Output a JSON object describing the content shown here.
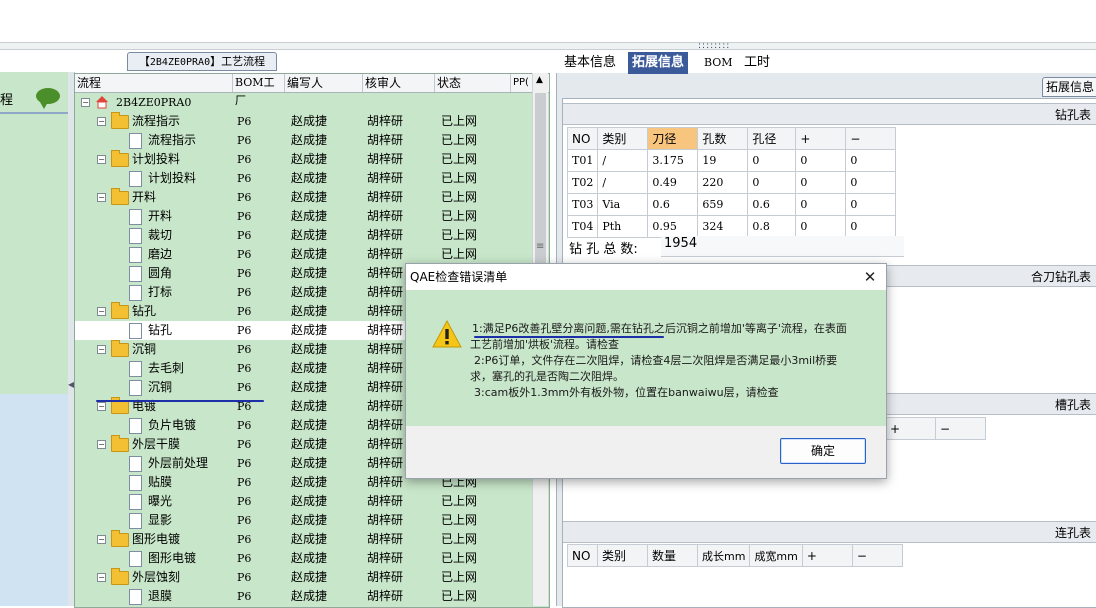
{
  "left_panel": {
    "label": "程",
    "comment_icon": "comment-bubble-icon"
  },
  "workflow_tab": {
    "bracket_open": "【",
    "code": "2B4ZE0PRA0",
    "bracket_close": "】",
    "label": "工艺流程"
  },
  "grid": {
    "columns": [
      "流程",
      "BOM工厂",
      "编写人",
      "核审人",
      "状态",
      "PP("
    ],
    "rows": [
      {
        "name": "2B4ZE0PRA0",
        "level": 0,
        "icon": "home-icon",
        "toggle": "−",
        "factory": "",
        "writer": "",
        "reviewer": "",
        "status": ""
      },
      {
        "name": "流程指示",
        "level": 1,
        "icon": "folder-icon",
        "toggle": "−",
        "factory": "P6",
        "writer": "赵成捷",
        "reviewer": "胡梓研",
        "status": "已上网"
      },
      {
        "name": "流程指示",
        "level": 2,
        "icon": "document-icon",
        "toggle": "",
        "factory": "P6",
        "writer": "赵成捷",
        "reviewer": "胡梓研",
        "status": "已上网"
      },
      {
        "name": "计划投料",
        "level": 1,
        "icon": "folder-icon",
        "toggle": "−",
        "factory": "P6",
        "writer": "赵成捷",
        "reviewer": "胡梓研",
        "status": "已上网"
      },
      {
        "name": "计划投料",
        "level": 2,
        "icon": "document-icon",
        "toggle": "",
        "factory": "P6",
        "writer": "赵成捷",
        "reviewer": "胡梓研",
        "status": "已上网"
      },
      {
        "name": "开料",
        "level": 1,
        "icon": "folder-icon",
        "toggle": "−",
        "factory": "P6",
        "writer": "赵成捷",
        "reviewer": "胡梓研",
        "status": "已上网"
      },
      {
        "name": "开料",
        "level": 2,
        "icon": "document-icon",
        "toggle": "",
        "factory": "P6",
        "writer": "赵成捷",
        "reviewer": "胡梓研",
        "status": "已上网"
      },
      {
        "name": "裁切",
        "level": 2,
        "icon": "document-icon",
        "toggle": "",
        "factory": "P6",
        "writer": "赵成捷",
        "reviewer": "胡梓研",
        "status": "已上网"
      },
      {
        "name": "磨边",
        "level": 2,
        "icon": "document-icon",
        "toggle": "",
        "factory": "P6",
        "writer": "赵成捷",
        "reviewer": "胡梓研",
        "status": "已上网"
      },
      {
        "name": "圆角",
        "level": 2,
        "icon": "document-icon",
        "toggle": "",
        "factory": "P6",
        "writer": "赵成捷",
        "reviewer": "胡梓研",
        "status": ""
      },
      {
        "name": "打标",
        "level": 2,
        "icon": "document-icon",
        "toggle": "",
        "factory": "P6",
        "writer": "赵成捷",
        "reviewer": "胡梓研",
        "status": ""
      },
      {
        "name": "钻孔",
        "level": 1,
        "icon": "folder-icon",
        "toggle": "−",
        "factory": "P6",
        "writer": "赵成捷",
        "reviewer": "胡梓研",
        "status": ""
      },
      {
        "name": "钻孔",
        "level": 2,
        "icon": "document-icon",
        "toggle": "",
        "factory": "P6",
        "writer": "赵成捷",
        "reviewer": "胡梓研",
        "status": "",
        "selected": true
      },
      {
        "name": "沉铜",
        "level": 1,
        "icon": "folder-icon",
        "toggle": "−",
        "factory": "P6",
        "writer": "赵成捷",
        "reviewer": "胡梓研",
        "status": ""
      },
      {
        "name": "去毛刺",
        "level": 2,
        "icon": "document-icon",
        "toggle": "",
        "factory": "P6",
        "writer": "赵成捷",
        "reviewer": "胡梓研",
        "status": ""
      },
      {
        "name": "沉铜",
        "level": 2,
        "icon": "document-icon",
        "toggle": "",
        "factory": "P6",
        "writer": "赵成捷",
        "reviewer": "胡梓研",
        "status": ""
      },
      {
        "name": "电镀",
        "level": 1,
        "icon": "folder-icon",
        "toggle": "−",
        "factory": "P6",
        "writer": "赵成捷",
        "reviewer": "胡梓研",
        "status": ""
      },
      {
        "name": "负片电镀",
        "level": 2,
        "icon": "document-icon",
        "toggle": "",
        "factory": "P6",
        "writer": "赵成捷",
        "reviewer": "胡梓研",
        "status": ""
      },
      {
        "name": "外层干膜",
        "level": 1,
        "icon": "folder-icon",
        "toggle": "−",
        "factory": "P6",
        "writer": "赵成捷",
        "reviewer": "胡梓研",
        "status": ""
      },
      {
        "name": "外层前处理",
        "level": 2,
        "icon": "document-icon",
        "toggle": "",
        "factory": "P6",
        "writer": "赵成捷",
        "reviewer": "胡梓研",
        "status": ""
      },
      {
        "name": "贴膜",
        "level": 2,
        "icon": "document-icon",
        "toggle": "",
        "factory": "P6",
        "writer": "赵成捷",
        "reviewer": "胡梓研",
        "status": "已上网"
      },
      {
        "name": "曝光",
        "level": 2,
        "icon": "document-icon",
        "toggle": "",
        "factory": "P6",
        "writer": "赵成捷",
        "reviewer": "胡梓研",
        "status": "已上网"
      },
      {
        "name": "显影",
        "level": 2,
        "icon": "document-icon",
        "toggle": "",
        "factory": "P6",
        "writer": "赵成捷",
        "reviewer": "胡梓研",
        "status": "已上网"
      },
      {
        "name": "图形电镀",
        "level": 1,
        "icon": "folder-icon",
        "toggle": "−",
        "factory": "P6",
        "writer": "赵成捷",
        "reviewer": "胡梓研",
        "status": "已上网"
      },
      {
        "name": "图形电镀",
        "level": 2,
        "icon": "document-icon",
        "toggle": "",
        "factory": "P6",
        "writer": "赵成捷",
        "reviewer": "胡梓研",
        "status": "已上网"
      },
      {
        "name": "外层蚀刻",
        "level": 1,
        "icon": "folder-icon",
        "toggle": "−",
        "factory": "P6",
        "writer": "赵成捷",
        "reviewer": "胡梓研",
        "status": "已上网"
      },
      {
        "name": "退膜",
        "level": 2,
        "icon": "document-icon",
        "toggle": "",
        "factory": "P6",
        "writer": "赵成捷",
        "reviewer": "胡梓研",
        "status": "已上网"
      }
    ]
  },
  "right_tabs": [
    {
      "label": "基本信息",
      "active": false
    },
    {
      "label": "拓展信息",
      "active": true
    },
    {
      "label": "BOM",
      "active": false
    },
    {
      "label": "工时",
      "active": false
    }
  ],
  "extended_info_tab": "拓展信息",
  "drill_table": {
    "title": "钻孔表",
    "headers": [
      "NO",
      "类别",
      "刀径",
      "孔数",
      "孔径",
      "+",
      "−"
    ],
    "highlight_header": "刀径",
    "rows": [
      [
        "T01",
        "/",
        "3.175",
        "19",
        "0",
        "0",
        "0"
      ],
      [
        "T02",
        "/",
        "0.49",
        "220",
        "0",
        "0",
        "0"
      ],
      [
        "T03",
        "Via",
        "0.6",
        "659",
        "0.6",
        "0",
        "0"
      ],
      [
        "T04",
        "Pth",
        "0.95",
        "324",
        "0.8",
        "0",
        "0"
      ]
    ],
    "total_label": "钻 孔 总 数:",
    "total_value": "1954"
  },
  "combo_drill_table": {
    "title": "合刀钻孔表"
  },
  "slot_table": {
    "title": "槽孔表",
    "headers": [
      "+",
      "−"
    ]
  },
  "link_table": {
    "title": "连孔表",
    "headers": [
      "NO",
      "类别",
      "数量",
      "成长mm",
      "成宽mm",
      "+",
      "−"
    ]
  },
  "dialog": {
    "title": "QAE检查错误清单",
    "warning_icon": "warning-icon",
    "close_icon": "close-icon",
    "lines": [
      "1:满足P6改善孔壁分离问题,需在钻孔之后沉铜之前增加'等离子'流程，在表面",
      "工艺前增加'烘板'流程。请检查",
      "2:P6订单，文件存在二次阻焊，请检查4层二次阻焊是否满足最小3mil桥要",
      "求，塞孔的孔是否陶二次阻焊。",
      "3:cam板外1.3mm外有板外物，位置在banwaiwu层，请检查"
    ],
    "ok_label": "确定"
  }
}
